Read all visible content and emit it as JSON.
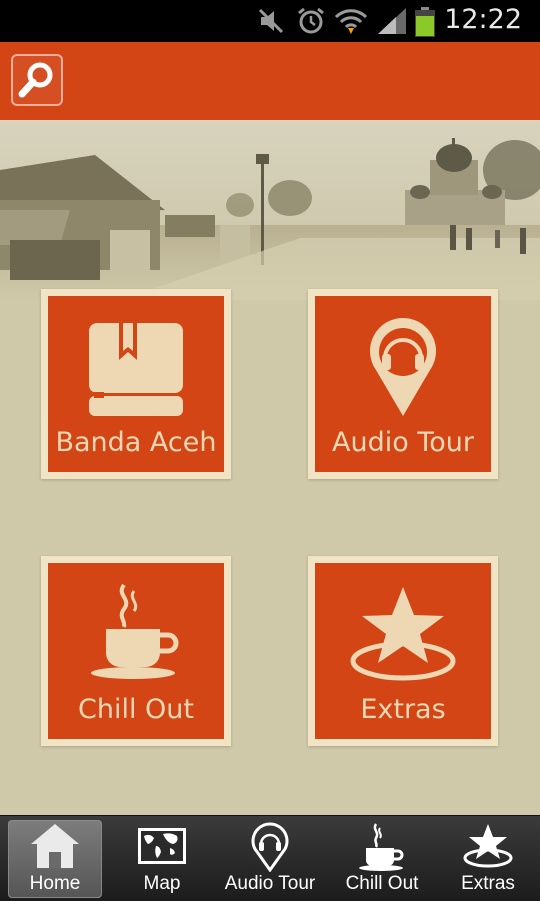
{
  "status_bar": {
    "time": "12:22",
    "icons": [
      "mute-icon",
      "alarm-icon",
      "wifi-icon",
      "signal-icon",
      "battery-icon"
    ]
  },
  "app_bar": {
    "search_icon": "search-icon"
  },
  "tiles": [
    {
      "label": "Banda Aceh",
      "icon": "book-bookmark-icon"
    },
    {
      "label": "Audio Tour",
      "icon": "map-pin-headphones-icon"
    },
    {
      "label": "Chill Out",
      "icon": "coffee-cup-icon"
    },
    {
      "label": "Extras",
      "icon": "star-icon"
    }
  ],
  "bottom_nav": {
    "items": [
      {
        "label": "Home",
        "icon": "home-icon",
        "active": true
      },
      {
        "label": "Map",
        "icon": "world-map-icon",
        "active": false
      },
      {
        "label": "Audio Tour",
        "icon": "map-pin-headphones-icon",
        "active": false
      },
      {
        "label": "Chill Out",
        "icon": "coffee-cup-icon",
        "active": false
      },
      {
        "label": "Extras",
        "icon": "star-icon",
        "active": false
      }
    ]
  },
  "colors": {
    "accent": "#d44515",
    "tile_border": "#f1e4c4",
    "tile_text": "#eed8b4",
    "background": "#cfc9a9",
    "nav_background": "#2a2a2a"
  }
}
